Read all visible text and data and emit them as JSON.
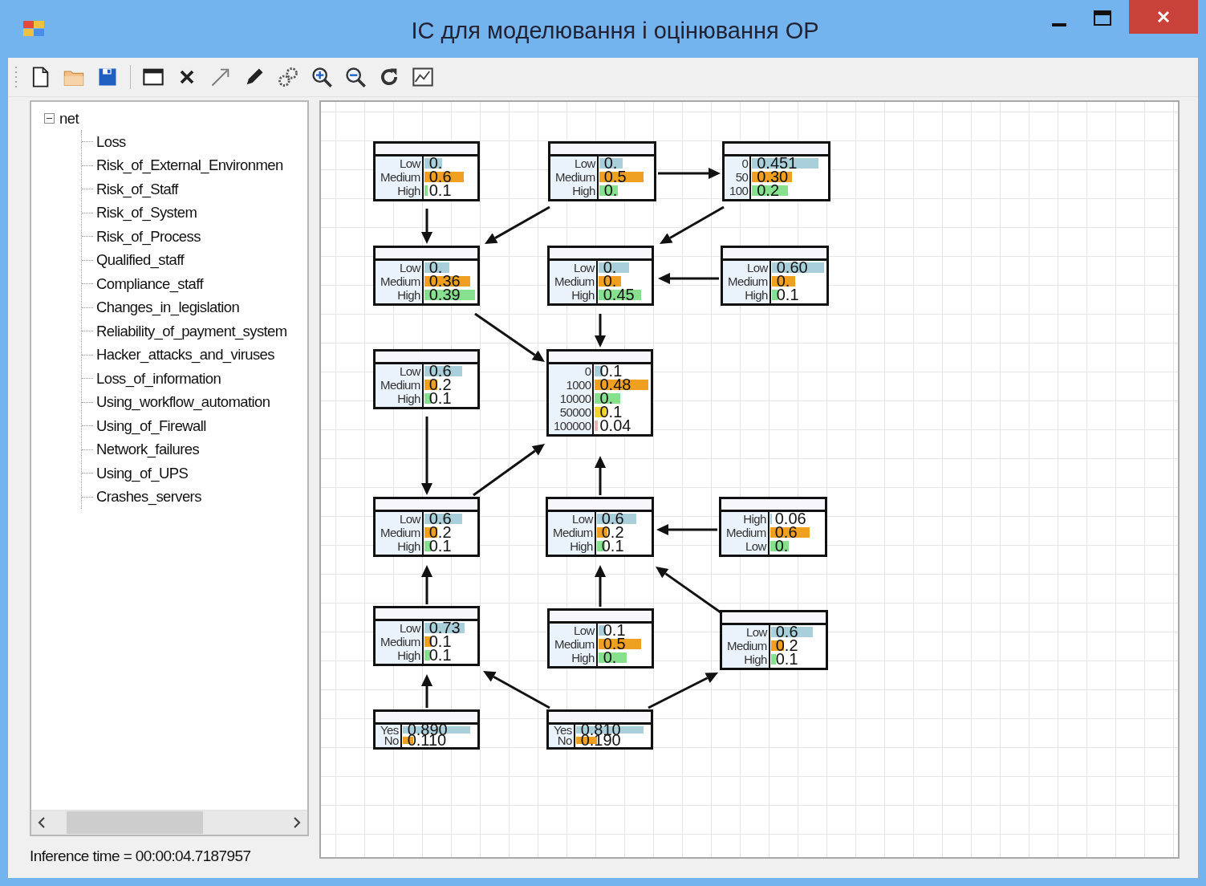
{
  "window": {
    "title": "ІС для моделювання і оцінювання ОР"
  },
  "toolbar": [
    {
      "kind": "new"
    },
    {
      "kind": "open"
    },
    {
      "kind": "save"
    },
    {
      "kind": "separator"
    },
    {
      "kind": "window"
    },
    {
      "kind": "delete"
    },
    {
      "kind": "arrow"
    },
    {
      "kind": "pencil"
    },
    {
      "kind": "gears"
    },
    {
      "kind": "zoom-in"
    },
    {
      "kind": "zoom-out"
    },
    {
      "kind": "refresh"
    },
    {
      "kind": "chart"
    }
  ],
  "tree": {
    "label": "net",
    "expanded": true,
    "children": [
      {
        "label": "Loss"
      },
      {
        "label": "Risk_of_External_Environmen"
      },
      {
        "label": "Risk_of_Staff"
      },
      {
        "label": "Risk_of_System"
      },
      {
        "label": "Risk_of_Process"
      },
      {
        "label": "Qualified_staff"
      },
      {
        "label": "Compliance_staff"
      },
      {
        "label": "Changes_in_legislation"
      },
      {
        "label": "Reliability_of_payment_system"
      },
      {
        "label": "Hacker_attacks_and_viruses"
      },
      {
        "label": "Loss_of_information"
      },
      {
        "label": "Using_workflow_automation"
      },
      {
        "label": "Using_of_Firewall"
      },
      {
        "label": "Network_failures"
      },
      {
        "label": "Using_of_UPS"
      },
      {
        "label": "Crashes_servers"
      }
    ]
  },
  "status": "Inference time = 00:00:04.7187957",
  "nodes": [
    {
      "states": [
        {
          "label": "Low",
          "value": "0.",
          "color": "#a9cfdb"
        },
        {
          "label": "Medium",
          "value": "0.6",
          "color": "#f0a020"
        },
        {
          "label": "High",
          "value": "0.1",
          "color": "#86e08e"
        }
      ]
    },
    {
      "states": [
        {
          "label": "Low",
          "value": "0.",
          "color": "#a9cfdb"
        },
        {
          "label": "Medium",
          "value": "0.5",
          "color": "#f0a020"
        },
        {
          "label": "High",
          "value": "0.",
          "color": "#86e08e"
        }
      ]
    },
    {
      "states": [
        {
          "label": "0",
          "value": "0.451",
          "color": "#a9cfdb"
        },
        {
          "label": "50",
          "value": "0.30",
          "color": "#f0a020"
        },
        {
          "label": "100",
          "value": "0.2",
          "color": "#86e08e"
        }
      ]
    },
    {
      "states": [
        {
          "label": "Low",
          "value": "0.",
          "color": "#a9cfdb"
        },
        {
          "label": "Medium",
          "value": "0.36",
          "color": "#f0a020"
        },
        {
          "label": "High",
          "value": "0.39",
          "color": "#86e08e"
        }
      ]
    },
    {
      "states": [
        {
          "label": "Low",
          "value": "0.",
          "color": "#a9cfdb"
        },
        {
          "label": "Medium",
          "value": "0.",
          "color": "#f0a020"
        },
        {
          "label": "High",
          "value": "0.45",
          "color": "#86e08e"
        }
      ]
    },
    {
      "states": [
        {
          "label": "Low",
          "value": "0.60",
          "color": "#a9cfdb"
        },
        {
          "label": "Medium",
          "value": "0.",
          "color": "#f0a020"
        },
        {
          "label": "High",
          "value": "0.1",
          "color": "#86e08e"
        }
      ]
    },
    {
      "states": [
        {
          "label": "Low",
          "value": "0.6",
          "color": "#a9cfdb"
        },
        {
          "label": "Medium",
          "value": "0.2",
          "color": "#f0a020"
        },
        {
          "label": "High",
          "value": "0.1",
          "color": "#86e08e"
        }
      ]
    },
    {
      "states": [
        {
          "label": "0",
          "value": "0.1",
          "color": "#a9cfdb"
        },
        {
          "label": "1000",
          "value": "0.48",
          "color": "#f0a020"
        },
        {
          "label": "10000",
          "value": "0.",
          "color": "#86e08e"
        },
        {
          "label": "50000",
          "value": "0.1",
          "color": "#f5d22c"
        },
        {
          "label": "100000",
          "value": "0.04",
          "color": "#e8b4b4"
        }
      ]
    },
    {
      "states": [
        {
          "label": "Low",
          "value": "0.6",
          "color": "#a9cfdb"
        },
        {
          "label": "Medium",
          "value": "0.2",
          "color": "#f0a020"
        },
        {
          "label": "High",
          "value": "0.1",
          "color": "#86e08e"
        }
      ]
    },
    {
      "states": [
        {
          "label": "Low",
          "value": "0.6",
          "color": "#a9cfdb"
        },
        {
          "label": "Medium",
          "value": "0.2",
          "color": "#f0a020"
        },
        {
          "label": "High",
          "value": "0.1",
          "color": "#86e08e"
        }
      ]
    },
    {
      "states": [
        {
          "label": "High",
          "value": "0.06",
          "color": "#a9cfdb"
        },
        {
          "label": "Medium",
          "value": "0.6",
          "color": "#f0a020"
        },
        {
          "label": "Low",
          "value": "0.",
          "color": "#86e08e"
        }
      ]
    },
    {
      "states": [
        {
          "label": "Low",
          "value": "0.73",
          "color": "#a9cfdb"
        },
        {
          "label": "Medium",
          "value": "0.1",
          "color": "#f0a020"
        },
        {
          "label": "High",
          "value": "0.1",
          "color": "#86e08e"
        }
      ]
    },
    {
      "states": [
        {
          "label": "Low",
          "value": "0.1",
          "color": "#a9cfdb"
        },
        {
          "label": "Medium",
          "value": "0.5",
          "color": "#f0a020"
        },
        {
          "label": "High",
          "value": "0.",
          "color": "#86e08e"
        }
      ]
    },
    {
      "states": [
        {
          "label": "Low",
          "value": "0.6",
          "color": "#a9cfdb"
        },
        {
          "label": "Medium",
          "value": "0.2",
          "color": "#f0a020"
        },
        {
          "label": "High",
          "value": "0.1",
          "color": "#86e08e"
        }
      ]
    },
    {
      "states": [
        {
          "label": "Yes",
          "value": "0.890",
          "color": "#a9cfdb"
        },
        {
          "label": "No",
          "value": "0.110",
          "color": "#f0a020"
        }
      ]
    },
    {
      "states": [
        {
          "label": "Yes",
          "value": "0.810",
          "color": "#a9cfdb"
        },
        {
          "label": "No",
          "value": "0.190",
          "color": "#f0a020"
        }
      ]
    }
  ]
}
